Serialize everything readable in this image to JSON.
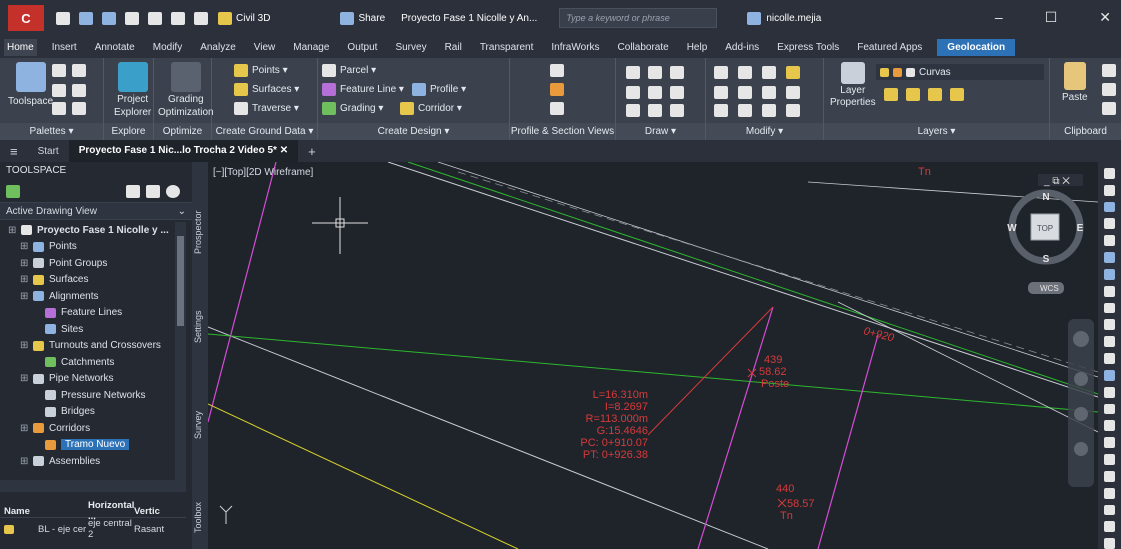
{
  "titlebar": {
    "logo": "C",
    "workspace": "Civil 3D",
    "share": "Share",
    "project": "Proyecto Fase 1 Nicolle y An...",
    "search_placeholder": "Type a keyword or phrase",
    "user": "nicolle.mejia"
  },
  "menu": [
    "Home",
    "Insert",
    "Annotate",
    "Modify",
    "Analyze",
    "View",
    "Manage",
    "Output",
    "Survey",
    "Rail",
    "Transparent",
    "InfraWorks",
    "Collaborate",
    "Help",
    "Add-ins",
    "Express Tools",
    "Featured Apps",
    "Geolocation"
  ],
  "ribbon": {
    "palettes": {
      "tool": "Toolspace",
      "label": "Palettes ▾"
    },
    "explore": {
      "project": "Project",
      "explorer": "Explorer",
      "label": "Explore"
    },
    "optimize": {
      "grading": "Grading",
      "optimization": "Optimization",
      "label": "Optimize"
    },
    "ground": {
      "points": "Points ▾",
      "surfaces": "Surfaces ▾",
      "traverse": "Traverse ▾",
      "label": "Create Ground Data ▾"
    },
    "design": {
      "parcel": "Parcel ▾",
      "feature_line": "Feature Line ▾",
      "profile": "Profile ▾",
      "grading": "Grading ▾",
      "corridor": "Corridor ▾",
      "label": "Create Design ▾"
    },
    "profile_views": {
      "label": "Profile & Section Views"
    },
    "draw": {
      "label": "Draw ▾"
    },
    "modify": {
      "label": "Modify ▾"
    },
    "layers": {
      "layer": "Layer",
      "properties": "Properties",
      "current": "Curvas",
      "label": "Layers ▾"
    },
    "clipboard": {
      "paste": "Paste",
      "label": "Clipboard"
    }
  },
  "tabs": {
    "start": "Start",
    "current": "Proyecto Fase 1 Nic...lo Trocha 2 Video 5*"
  },
  "toolspace": {
    "title": "TOOLSPACE",
    "view": "Active Drawing View",
    "tree": [
      {
        "label": "Proyecto Fase 1 Nicolle y ...",
        "indent": 0,
        "color": "#e6e6e6",
        "bold": true
      },
      {
        "label": "Points",
        "indent": 1,
        "color": "#8fb3e0"
      },
      {
        "label": "Point Groups",
        "indent": 1,
        "color": "#c9d0da"
      },
      {
        "label": "Surfaces",
        "indent": 1,
        "color": "#e7c74b"
      },
      {
        "label": "Alignments",
        "indent": 1,
        "color": "#8fb3e0"
      },
      {
        "label": "Feature Lines",
        "indent": 2,
        "color": "#b56fd6"
      },
      {
        "label": "Sites",
        "indent": 2,
        "color": "#8fb3e0"
      },
      {
        "label": "Turnouts and Crossovers",
        "indent": 1,
        "color": "#e7c74b"
      },
      {
        "label": "Catchments",
        "indent": 2,
        "color": "#6fbf5f"
      },
      {
        "label": "Pipe Networks",
        "indent": 1,
        "color": "#c9d0da"
      },
      {
        "label": "Pressure Networks",
        "indent": 2,
        "color": "#c9d0da"
      },
      {
        "label": "Bridges",
        "indent": 2,
        "color": "#c9d0da"
      },
      {
        "label": "Corridors",
        "indent": 1,
        "color": "#e89a3c"
      },
      {
        "label": "Tramo Nuevo",
        "indent": 2,
        "color": "#e89a3c",
        "selected": true
      },
      {
        "label": "Assemblies",
        "indent": 1,
        "color": "#c9d0da"
      }
    ],
    "table": {
      "headers": [
        "Name",
        "Horizontal ...",
        "Vertic"
      ],
      "row": [
        "BL - eje cer",
        "eje central 2",
        "Rasant"
      ]
    }
  },
  "sidetabs": [
    "Prospector",
    "Settings",
    "Survey",
    "Toolbox"
  ],
  "viewport": {
    "label": "[−][Top][2D Wireframe]",
    "station": "0+920",
    "pts": [
      {
        "num": "439",
        "elev": "58.62",
        "desc": "Poste"
      },
      {
        "num": "440",
        "elev": "58.57",
        "desc": "Tn"
      }
    ],
    "top_label": "Tn",
    "curve": [
      "L=16.310m",
      "I=8.2697",
      "R=113.000m",
      "G:15.4646",
      "PC: 0+910.07",
      "PT: 0+926.38"
    ],
    "viewcube": {
      "n": "N",
      "s": "S",
      "e": "E",
      "w": "W",
      "top": "TOP",
      "wcs": "WCS"
    }
  }
}
